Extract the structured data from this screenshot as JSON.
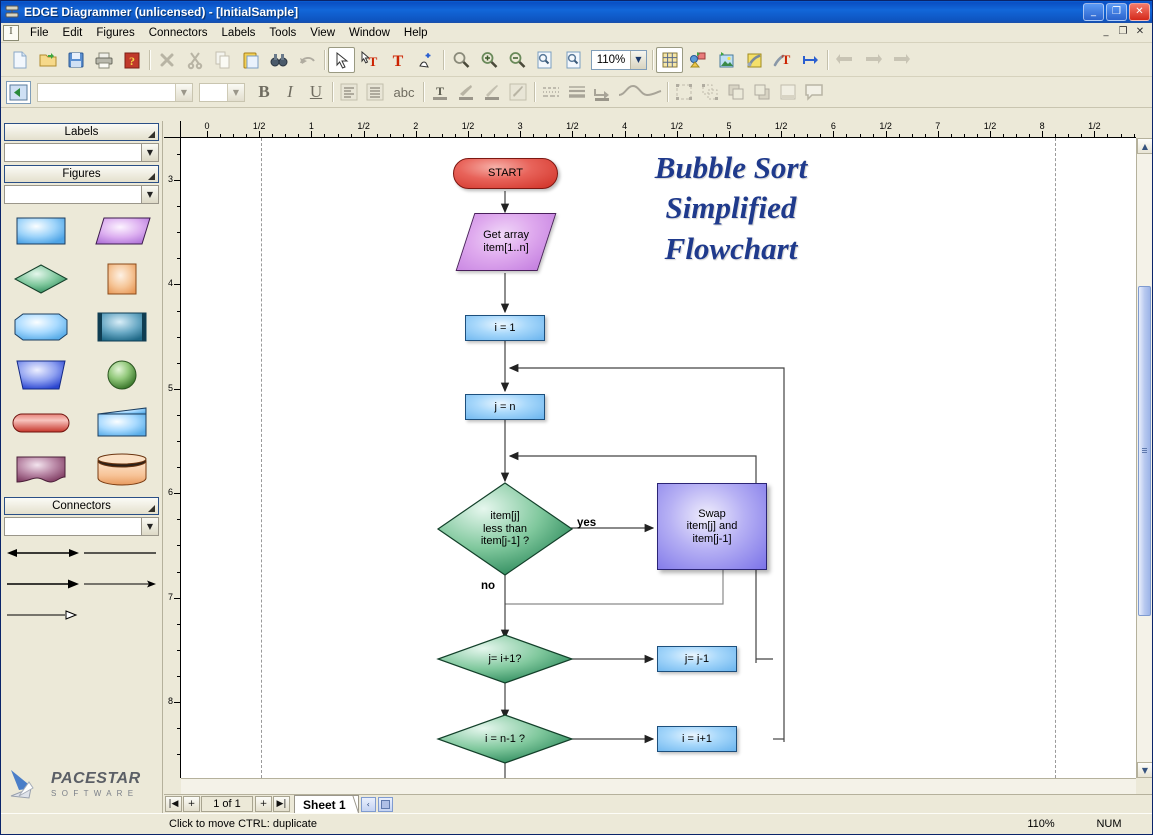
{
  "window": {
    "title": "EDGE Diagrammer (unlicensed) - [InitialSample]",
    "app_icon": "edge-app-icon",
    "minimize": "_",
    "maximize": "❐",
    "close": "✕"
  },
  "mdi_buttons": {
    "minimize": "_",
    "restore": "❐",
    "close": "✕"
  },
  "menu": {
    "items": [
      {
        "label": "File",
        "name": "menu-file"
      },
      {
        "label": "Edit",
        "name": "menu-edit"
      },
      {
        "label": "Figures",
        "name": "menu-figures"
      },
      {
        "label": "Connectors",
        "name": "menu-connectors"
      },
      {
        "label": "Labels",
        "name": "menu-labels"
      },
      {
        "label": "Tools",
        "name": "menu-tools"
      },
      {
        "label": "View",
        "name": "menu-view"
      },
      {
        "label": "Window",
        "name": "menu-window"
      },
      {
        "label": "Help",
        "name": "menu-help"
      }
    ]
  },
  "toolbar_main": {
    "zoom_value": "110%",
    "buttons": [
      {
        "name": "new-document-icon",
        "glyph": "new"
      },
      {
        "name": "open-folder-icon",
        "glyph": "open"
      },
      {
        "name": "save-disk-icon",
        "glyph": "save"
      },
      {
        "name": "print-icon",
        "glyph": "print"
      },
      {
        "name": "help-book-icon",
        "glyph": "helpbook"
      },
      {
        "name": "delete-x-icon",
        "glyph": "delete"
      },
      {
        "name": "cut-scissors-icon",
        "glyph": "cut"
      },
      {
        "name": "copy-icon",
        "glyph": "copy"
      },
      {
        "name": "paste-clipboard-icon",
        "glyph": "paste"
      },
      {
        "name": "find-binoculars-icon",
        "glyph": "find"
      },
      {
        "name": "undo-arrow-icon",
        "glyph": "undo"
      },
      {
        "name": "select-pointer-icon",
        "glyph": "pointer"
      },
      {
        "name": "text-select-icon",
        "glyph": "textselect"
      },
      {
        "name": "insert-text-icon",
        "glyph": "text"
      },
      {
        "name": "point-edit-icon",
        "glyph": "pointedit"
      },
      {
        "name": "zoom-tool-icon",
        "glyph": "zoomtool"
      },
      {
        "name": "zoom-in-icon",
        "glyph": "zoomin"
      },
      {
        "name": "zoom-out-icon",
        "glyph": "zoomout"
      },
      {
        "name": "zoom-page-icon",
        "glyph": "zoompage"
      },
      {
        "name": "zoom-fit-icon",
        "glyph": "zoomfit"
      },
      {
        "name": "grid-icon",
        "glyph": "grid"
      },
      {
        "name": "figure-properties-icon",
        "glyph": "figprops"
      },
      {
        "name": "image-properties-icon",
        "glyph": "imgprops"
      },
      {
        "name": "settings-wrench-icon",
        "glyph": "wrench"
      },
      {
        "name": "text-tool-icon",
        "glyph": "texttool"
      },
      {
        "name": "flow-arrow-icon",
        "glyph": "flowarrow"
      },
      {
        "name": "send-backward-icon",
        "glyph": "back"
      },
      {
        "name": "bring-forward-icon",
        "glyph": "fwd"
      },
      {
        "name": "bring-front-icon",
        "glyph": "front"
      }
    ]
  },
  "toolbar_format": {
    "font_name": "",
    "font_size": "",
    "bold_label": "B",
    "italic_label": "I",
    "underline_label": "U",
    "spellcheck_label": "abc",
    "buttons": [
      {
        "name": "indent-panel-icon"
      },
      {
        "name": "align-left-icon"
      },
      {
        "name": "align-justify-icon"
      },
      {
        "name": "text-color-icon"
      },
      {
        "name": "fill-color-icon"
      },
      {
        "name": "line-color-icon"
      },
      {
        "name": "shadow-color-icon"
      },
      {
        "name": "line-style-dotted-icon"
      },
      {
        "name": "line-weight-icon"
      },
      {
        "name": "arrow-style-icon"
      },
      {
        "name": "curve-style-icon"
      },
      {
        "name": "group-icon"
      },
      {
        "name": "ungroup-icon"
      },
      {
        "name": "bring-to-front-icon"
      },
      {
        "name": "send-to-back-icon"
      },
      {
        "name": "new-layer-icon"
      },
      {
        "name": "comment-balloon-icon"
      }
    ]
  },
  "sidebar": {
    "labels_section": {
      "title": "Labels",
      "combo_value": ""
    },
    "figures_section": {
      "title": "Figures",
      "combo_value": ""
    },
    "connectors_section": {
      "title": "Connectors",
      "combo_value": ""
    },
    "figure_shapes": [
      {
        "name": "shape-process-rectangle",
        "kind": "rect",
        "color": "#6ab4ee"
      },
      {
        "name": "shape-data-parallelogram",
        "kind": "parallelogram",
        "color": "#c47fe0"
      },
      {
        "name": "shape-decision-diamond",
        "kind": "diamond",
        "color": "#3f9e6e"
      },
      {
        "name": "shape-square-orange",
        "kind": "square",
        "color": "#f0a469"
      },
      {
        "name": "shape-preparation-hexagon",
        "kind": "hexagon",
        "color": "#6ab4ee"
      },
      {
        "name": "shape-box-3d-teal",
        "kind": "box3d",
        "color": "#2f7fa3"
      },
      {
        "name": "shape-trapezoid-blue",
        "kind": "trapezoid",
        "color": "#4a5fe0"
      },
      {
        "name": "shape-circle-green",
        "kind": "circle",
        "color": "#63aa4a"
      },
      {
        "name": "shape-terminator-red",
        "kind": "rounded",
        "color": "#d93b2f"
      },
      {
        "name": "shape-slanted-rect-blue",
        "kind": "slant",
        "color": "#6ab4ee"
      },
      {
        "name": "shape-document-purple",
        "kind": "document",
        "color": "#9c5a84"
      },
      {
        "name": "shape-cylinder-orange",
        "kind": "cylinder",
        "color": "#f0a469"
      }
    ],
    "connector_shapes": [
      {
        "name": "connector-double-arrow"
      },
      {
        "name": "connector-plain-line"
      },
      {
        "name": "connector-single-arrow"
      },
      {
        "name": "connector-thin-arrow"
      },
      {
        "name": "connector-open-arrow"
      }
    ],
    "logo": {
      "brand": "PACESTAR",
      "tagline": "S O F T W A R E"
    }
  },
  "rulers": {
    "horizontal_labels": [
      "0",
      "1/2",
      "1",
      "1/2",
      "2",
      "1/2",
      "3",
      "1/2",
      "4",
      "1/2",
      "5",
      "1/2",
      "6",
      "1/2",
      "7",
      "1/2",
      "8",
      "1/2"
    ],
    "vertical_labels": [
      "3",
      "4",
      "5",
      "6",
      "7",
      "8"
    ]
  },
  "sheetbar": {
    "first_label": "⏮",
    "add_label_left": "+",
    "page_count": "1 of 1",
    "add_label_right": "+",
    "last_label": "⏭",
    "tab_label": "Sheet 1",
    "scroll_left": "‹",
    "scroll_box": "▒"
  },
  "statusbar": {
    "hint": "Click to move   CTRL: duplicate",
    "zoom": "110%",
    "num_lock": "NUM"
  },
  "diagram": {
    "title_lines": [
      "Bubble Sort",
      "Simplified",
      "Flowchart"
    ],
    "nodes": [
      {
        "id": "start",
        "name": "node-start",
        "type": "terminator",
        "text": "START"
      },
      {
        "id": "getarray",
        "name": "node-get-array",
        "type": "io",
        "text": "Get array\nitem[1..n]"
      },
      {
        "id": "i1",
        "name": "node-i-equals-1",
        "type": "process",
        "text": "i = 1"
      },
      {
        "id": "jn",
        "name": "node-j-equals-n",
        "type": "process",
        "text": "j = n"
      },
      {
        "id": "cmp",
        "name": "node-compare-decision",
        "type": "decision",
        "text": "item[j]\nless than\nitem[j-1] ?"
      },
      {
        "id": "swap",
        "name": "node-swap",
        "type": "process-alt",
        "text": "Swap\nitem[j] and\nitem[j-1]"
      },
      {
        "id": "jeq",
        "name": "node-j-equals-i-plus-1-decision",
        "type": "decision",
        "text": "j= i+1?"
      },
      {
        "id": "jdec",
        "name": "node-j-equals-j-minus-1",
        "type": "process",
        "text": "j= j-1"
      },
      {
        "id": "ieq",
        "name": "node-i-equals-n-minus-1-decision",
        "type": "decision",
        "text": "i = n-1 ?"
      },
      {
        "id": "iinc",
        "name": "node-i-equals-i-plus-1",
        "type": "process",
        "text": "i = i+1"
      }
    ],
    "edge_labels": [
      {
        "name": "edge-label-yes",
        "text": "yes"
      },
      {
        "name": "edge-label-no",
        "text": "no"
      }
    ]
  }
}
